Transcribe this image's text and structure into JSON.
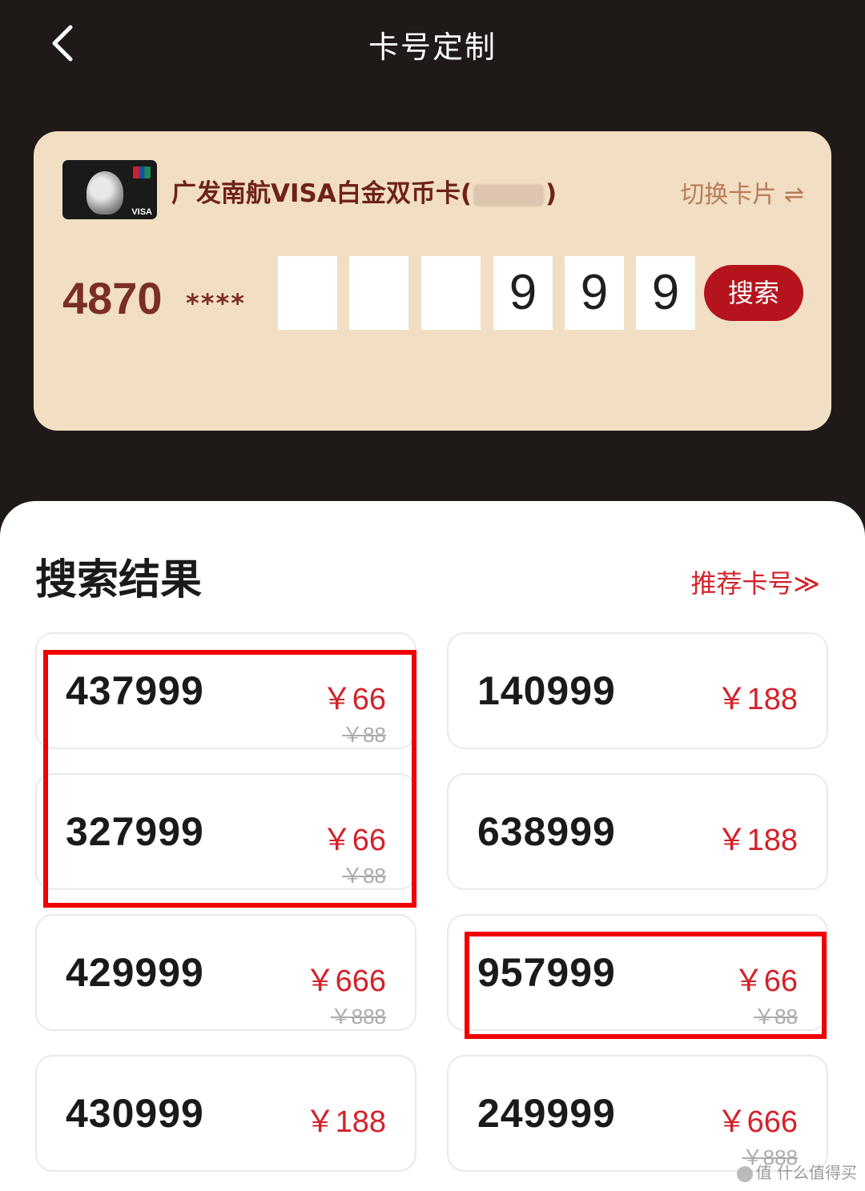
{
  "header": {
    "title": "卡号定制",
    "back_icon": "chevron-left-icon"
  },
  "card": {
    "name_prefix": "广发南航VISA白金双币卡(",
    "name_suffix": ")",
    "switch_label": "切换卡片 ⇌",
    "number_prefix": "4870",
    "number_mask": "****",
    "digits": [
      "",
      "",
      "",
      "9",
      "9",
      "9"
    ],
    "search_label": "搜索"
  },
  "results": {
    "title": "搜索结果",
    "recommend_label": "推荐卡号≫",
    "items": [
      {
        "number": "437999",
        "price": "￥66",
        "original": "￥88"
      },
      {
        "number": "140999",
        "price": "￥188",
        "original": ""
      },
      {
        "number": "327999",
        "price": "￥66",
        "original": "￥88"
      },
      {
        "number": "638999",
        "price": "￥188",
        "original": ""
      },
      {
        "number": "429999",
        "price": "￥666",
        "original": "￥888"
      },
      {
        "number": "957999",
        "price": "￥66",
        "original": "￥88"
      },
      {
        "number": "430999",
        "price": "￥188",
        "original": ""
      },
      {
        "number": "249999",
        "price": "￥666",
        "original": "￥888"
      }
    ]
  },
  "colors": {
    "accent": "#d3222a",
    "highlight": "#f00000",
    "panel": "#f2dfc3",
    "background": "#1f1a18"
  },
  "watermark": "值 什么值得买"
}
